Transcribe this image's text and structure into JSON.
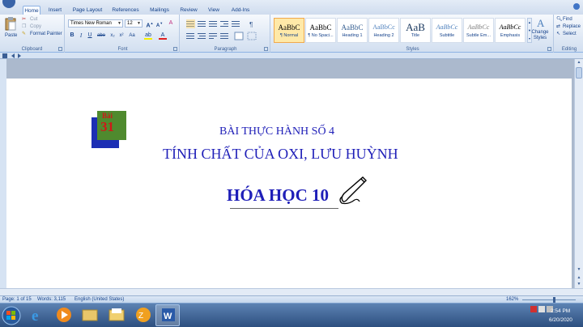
{
  "tabs": [
    "Home",
    "Insert",
    "Page Layout",
    "References",
    "Mailings",
    "Review",
    "View",
    "Add-Ins"
  ],
  "active_tab": "Home",
  "clipboard": {
    "paste": "Paste",
    "cut": "Cut",
    "copy": "Copy",
    "format_painter": "Format Painter",
    "label": "Clipboard"
  },
  "font": {
    "name": "Times New Roman",
    "size": "12",
    "label": "Font",
    "bold": "B",
    "italic": "I",
    "underline": "U"
  },
  "paragraph": {
    "label": "Paragraph"
  },
  "styles": {
    "items": [
      {
        "sample": "AaBbC",
        "name": "¶ Normal"
      },
      {
        "sample": "AaBbC",
        "name": "¶ No Spaci..."
      },
      {
        "sample": "AaBbC",
        "name": "Heading 1"
      },
      {
        "sample": "AaBbCc",
        "name": "Heading 2"
      },
      {
        "sample": "AaB",
        "name": "Title"
      },
      {
        "sample": "AaBbCc",
        "name": "Subtitle"
      },
      {
        "sample": "AaBbCc",
        "name": "Subtle Em..."
      },
      {
        "sample": "AaBbCc",
        "name": "Emphasis"
      }
    ],
    "change_styles": "Change Styles",
    "label": "Styles"
  },
  "editing": {
    "find": "Find",
    "replace": "Replace",
    "select": "Select",
    "label": "Editing"
  },
  "document": {
    "badge_top": "Bài",
    "badge_number": "31",
    "line1": "BÀI THỰC HÀNH SỐ 4",
    "line2": "TÍNH CHẤT CỦA OXI, LƯU HUỲNH",
    "line3": "HÓA HỌC 10"
  },
  "status": {
    "page": "Page: 1 of 15",
    "words": "Words: 3,115",
    "language": "English (United States)",
    "zoom": "162%"
  },
  "taskbar": {
    "time": "2:54 PM",
    "date": "6/20/2020"
  },
  "colors": {
    "doc_text": "#1f1fb8",
    "badge_green": "#4f8a2e",
    "badge_blue": "#1c2fb4",
    "badge_red": "#d01818"
  }
}
